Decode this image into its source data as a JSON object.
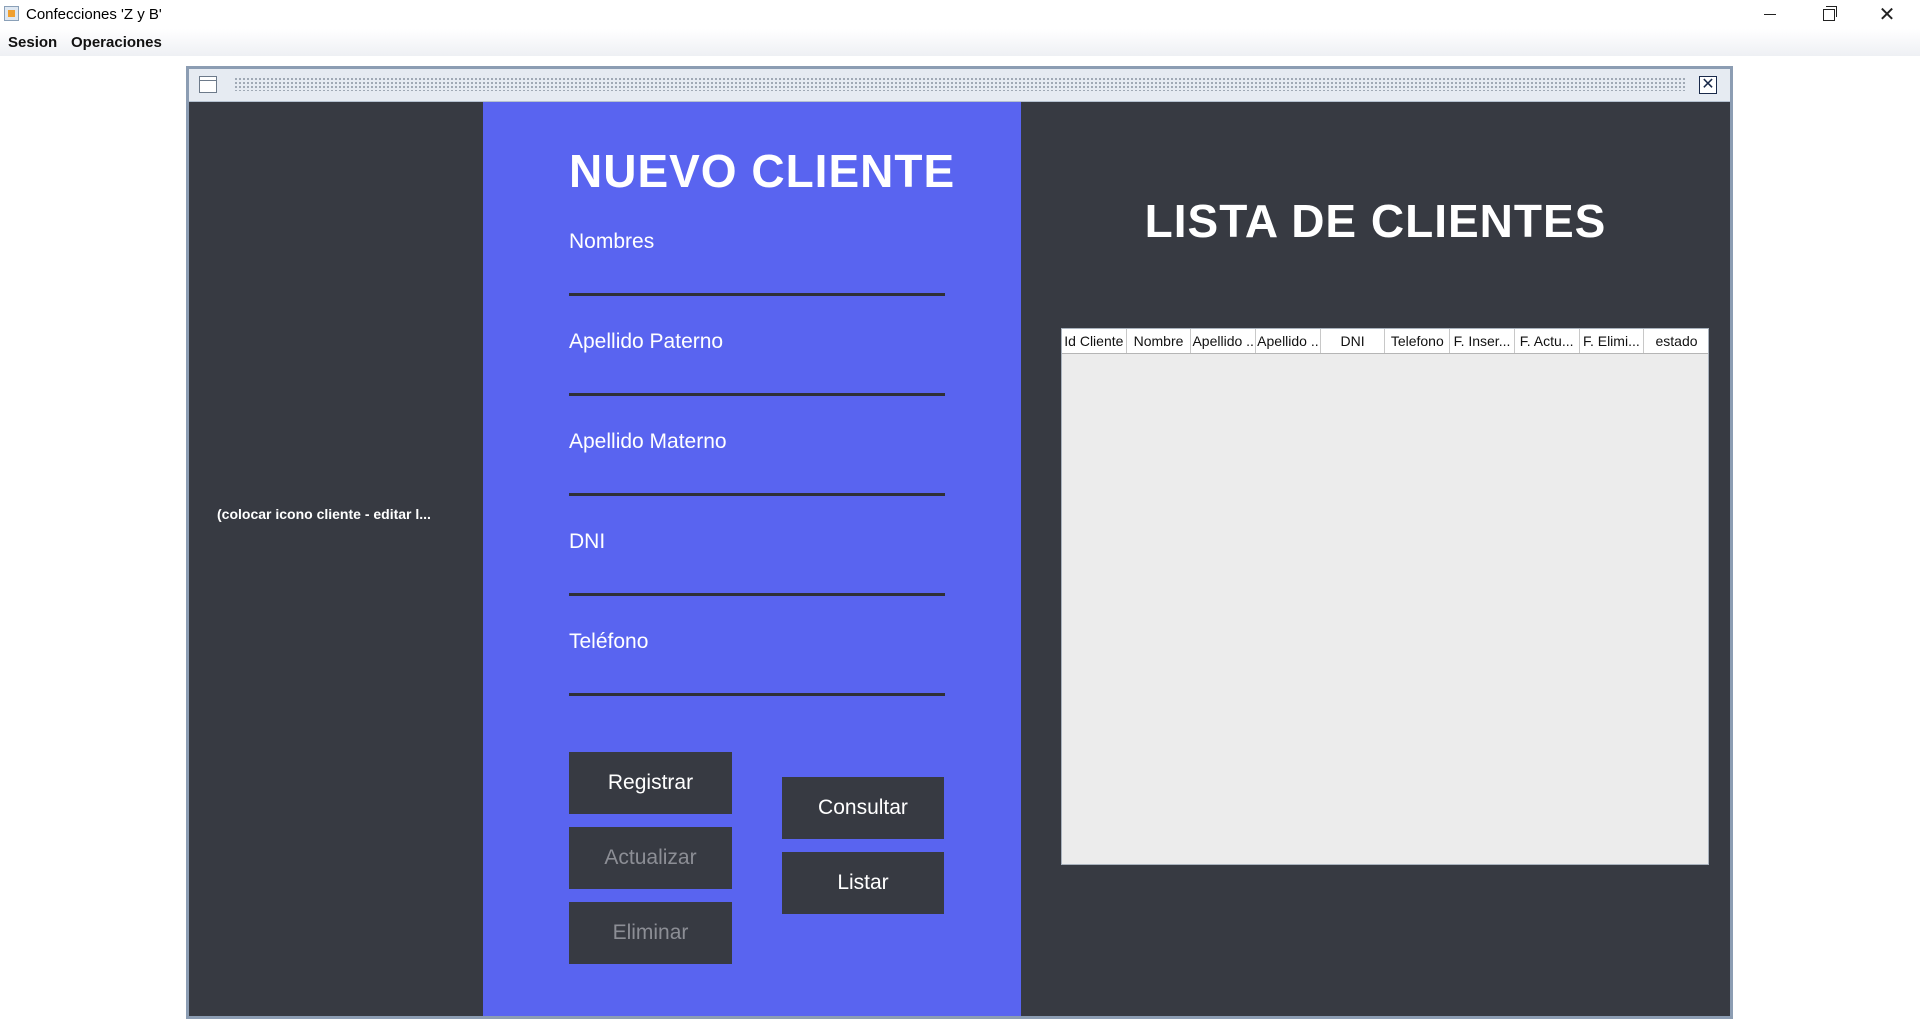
{
  "window": {
    "title": "Confecciones 'Z y B'",
    "controls": {
      "minimize": "minimize-icon",
      "maximize": "restore-icon",
      "close": "close-icon"
    }
  },
  "menubar": {
    "items": [
      {
        "label": "Sesion"
      },
      {
        "label": "Operaciones"
      }
    ]
  },
  "internal_frame": {
    "close_icon": "close-icon"
  },
  "left_panel": {
    "icon_placeholder": "(colocar icono cliente - editar l..."
  },
  "form": {
    "title": "NUEVO CLIENTE",
    "fields": [
      {
        "label": "Nombres",
        "value": ""
      },
      {
        "label": "Apellido Paterno",
        "value": ""
      },
      {
        "label": "Apellido Materno",
        "value": ""
      },
      {
        "label": "DNI",
        "value": ""
      },
      {
        "label": "Teléfono",
        "value": ""
      }
    ],
    "buttons": {
      "registrar": "Registrar",
      "actualizar": "Actualizar",
      "eliminar": "Eliminar",
      "consultar": "Consultar",
      "listar": "Listar"
    }
  },
  "list": {
    "title": "LISTA DE CLIENTES",
    "columns": [
      "Id Cliente",
      "Nombre",
      "Apellido ..",
      "Apellido ..",
      "DNI",
      "Telefono",
      "F. Inser...",
      "F. Actu...",
      "F. Elimi...",
      "estado"
    ],
    "rows": []
  },
  "colors": {
    "accent_panel": "#5964f0",
    "dark_panel": "#373a42",
    "disabled_text": "#8c8e95"
  }
}
